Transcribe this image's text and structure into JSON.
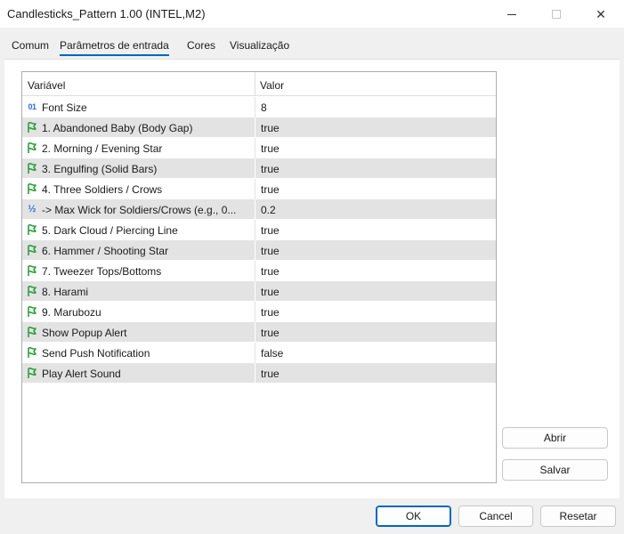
{
  "window": {
    "title": "Candlesticks_Pattern 1.00 (INTEL,M2)",
    "minimize": "—",
    "maximize": "☐",
    "close": "✕"
  },
  "tabs": [
    {
      "label": "Comum"
    },
    {
      "label": "Parâmetros de entrada"
    },
    {
      "label": "Cores"
    },
    {
      "label": "Visualização"
    }
  ],
  "grid": {
    "header_variable": "Variável",
    "header_value": "Valor",
    "rows": [
      {
        "icon": "int-icon",
        "label": "Font Size",
        "value": "8"
      },
      {
        "icon": "bool-icon",
        "label": "1. Abandoned Baby (Body Gap)",
        "value": "true"
      },
      {
        "icon": "bool-icon",
        "label": "2. Morning / Evening Star",
        "value": "true"
      },
      {
        "icon": "bool-icon",
        "label": "3. Engulfing (Solid Bars)",
        "value": "true"
      },
      {
        "icon": "bool-icon",
        "label": "4. Three Soldiers / Crows",
        "value": "true"
      },
      {
        "icon": "double-icon",
        "label": "-> Max Wick for Soldiers/Crows (e.g., 0...",
        "value": "0.2"
      },
      {
        "icon": "bool-icon",
        "label": "5. Dark Cloud / Piercing Line",
        "value": "true"
      },
      {
        "icon": "bool-icon",
        "label": "6. Hammer / Shooting Star",
        "value": "true"
      },
      {
        "icon": "bool-icon",
        "label": "7. Tweezer Tops/Bottoms",
        "value": "true"
      },
      {
        "icon": "bool-icon",
        "label": "8. Harami",
        "value": "true"
      },
      {
        "icon": "bool-icon",
        "label": "9. Marubozu",
        "value": "true"
      },
      {
        "icon": "bool-icon",
        "label": "Show Popup Alert",
        "value": "true"
      },
      {
        "icon": "bool-icon",
        "label": "Send Push Notification",
        "value": "false"
      },
      {
        "icon": "bool-icon",
        "label": "Play Alert Sound",
        "value": "true"
      }
    ]
  },
  "buttons": {
    "open": "Abrir",
    "save": "Salvar",
    "ok": "OK",
    "cancel": "Cancel",
    "reset": "Resetar"
  },
  "colors": {
    "accent": "#0067c0",
    "bool_icon": "#2e9e3e",
    "type_icon": "#2f6fd6",
    "alt_row": "#e3e3e3"
  }
}
